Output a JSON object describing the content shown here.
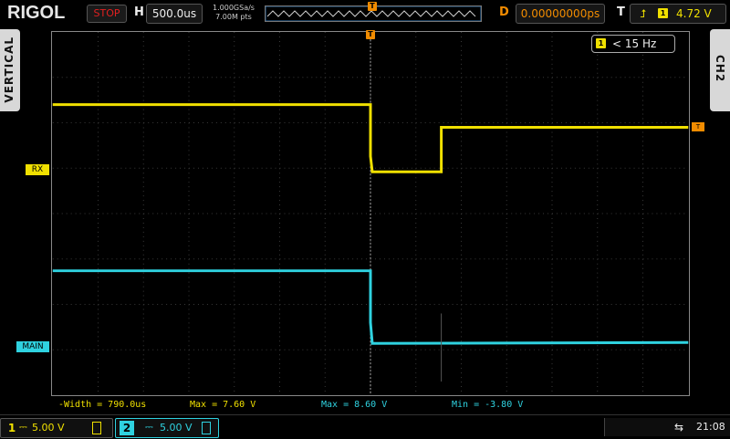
{
  "brand": "RIGOL",
  "run_state": "STOP",
  "horizontal": {
    "label": "H",
    "timebase": "500.0us"
  },
  "sample": {
    "rate": "1.000GSa/s",
    "points": "7.00M pts"
  },
  "delay": {
    "label": "D",
    "value": "0.00000000ps"
  },
  "trigger": {
    "label": "T",
    "source": "1",
    "level": "4.72 V"
  },
  "left_tab": "VERTICAL",
  "right_tab": "CH2",
  "frequency_box": {
    "source": "1",
    "text": "< 15 Hz"
  },
  "markers": {
    "rx": "RX",
    "main": "MAIN",
    "trigger_marker": "T",
    "trigger_top": "T"
  },
  "measurements": [
    {
      "text": "-Width = 790.0us",
      "color": "#f0e000"
    },
    {
      "text": "Max = 7.60 V",
      "color": "#f0e000"
    },
    {
      "text": "Max = 8.60 V",
      "color": "#2fd2e0"
    },
    {
      "text": "Min = -3.80 V",
      "color": "#2fd2e0"
    }
  ],
  "channels": [
    {
      "num": "1",
      "scale": "5.00 V",
      "color": "#f0e000"
    },
    {
      "num": "2",
      "scale": "5.00 V",
      "color": "#2fd2e0"
    }
  ],
  "status": {
    "usb": "⇆",
    "time": "21:08"
  },
  "colors": {
    "ch1": "#f0e000",
    "ch2": "#2fd2e0",
    "trigger": "#f28c00"
  }
}
